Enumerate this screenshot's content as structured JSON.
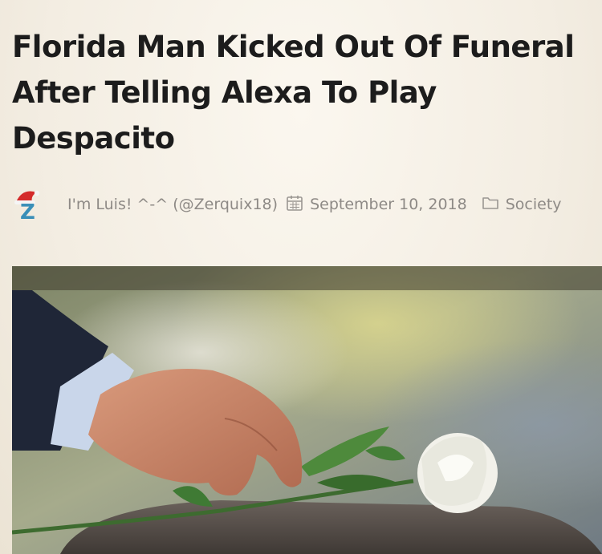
{
  "article": {
    "headline": "Florida Man Kicked Out Of Funeral After Telling Alexa To Play Despacito",
    "author": "I'm Luis! ^-^ (@Zerquix18)",
    "date": "September 10, 2018",
    "category": "Society"
  },
  "avatar": {
    "letter": "Z",
    "icon": "santa-hat-icon"
  },
  "icons": {
    "date": "calendar-icon",
    "category": "folder-icon"
  },
  "colors": {
    "headline": "#1c1c1c",
    "meta": "#8e8a86",
    "avatar_letter": "#3a8fb8",
    "santa_hat": "#d42b2b",
    "background": "#f4efe6"
  }
}
